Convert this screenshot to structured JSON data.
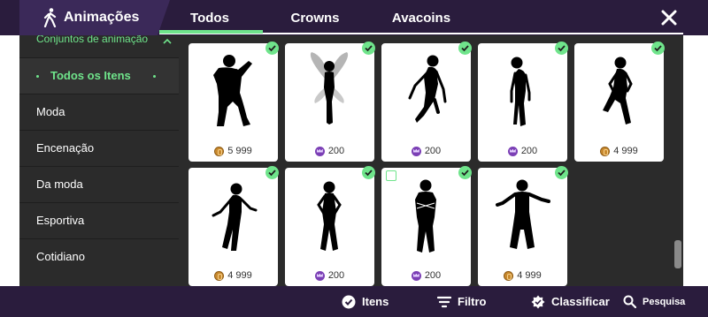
{
  "header": {
    "title": "Animações",
    "title_icon": "walking-person-icon",
    "tabs": [
      {
        "label": "Todos",
        "active": true
      },
      {
        "label": "Crowns",
        "active": false
      },
      {
        "label": "Avacoins",
        "active": false
      }
    ],
    "close_icon": "close-icon"
  },
  "sidebar": {
    "group_label": "Conjuntos de animação",
    "items": [
      {
        "label": "Todos os Itens",
        "active": true
      },
      {
        "label": "Moda"
      },
      {
        "label": "Encenação"
      },
      {
        "label": "Da moda"
      },
      {
        "label": "Esportiva"
      },
      {
        "label": "Cotidiano"
      }
    ]
  },
  "cards": [
    {
      "pose": "dance-crouch",
      "price": "5 999",
      "currency": "avacoin",
      "owned": true
    },
    {
      "pose": "fairy",
      "price": "200",
      "currency": "crown",
      "owned": true
    },
    {
      "pose": "jump-float",
      "price": "200",
      "currency": "crown",
      "owned": true
    },
    {
      "pose": "lean-back",
      "price": "200",
      "currency": "crown",
      "owned": true
    },
    {
      "pose": "kick-up",
      "price": "4 999",
      "currency": "avacoin",
      "owned": true
    },
    {
      "pose": "arms-out-lean",
      "price": "4 999",
      "currency": "avacoin",
      "owned": true
    },
    {
      "pose": "hands-on-hips",
      "price": "200",
      "currency": "crown",
      "owned": true
    },
    {
      "pose": "arms-crossed",
      "price": "200",
      "currency": "crown",
      "owned": true,
      "preview": true
    },
    {
      "pose": "arms-wide",
      "price": "4 999",
      "currency": "avacoin",
      "owned": true
    }
  ],
  "footer": {
    "items_label": "Itens",
    "filter_label": "Filtro",
    "sort_label": "Classificar",
    "search_label": "Pesquisa"
  },
  "colors": {
    "header_bg": "#2a1c3d",
    "title_bg": "#3b2959",
    "accent_green": "#6fe48b",
    "panel_bg": "#2b2b2b",
    "coin": "#c8892e",
    "crown": "#7b3fb5"
  }
}
